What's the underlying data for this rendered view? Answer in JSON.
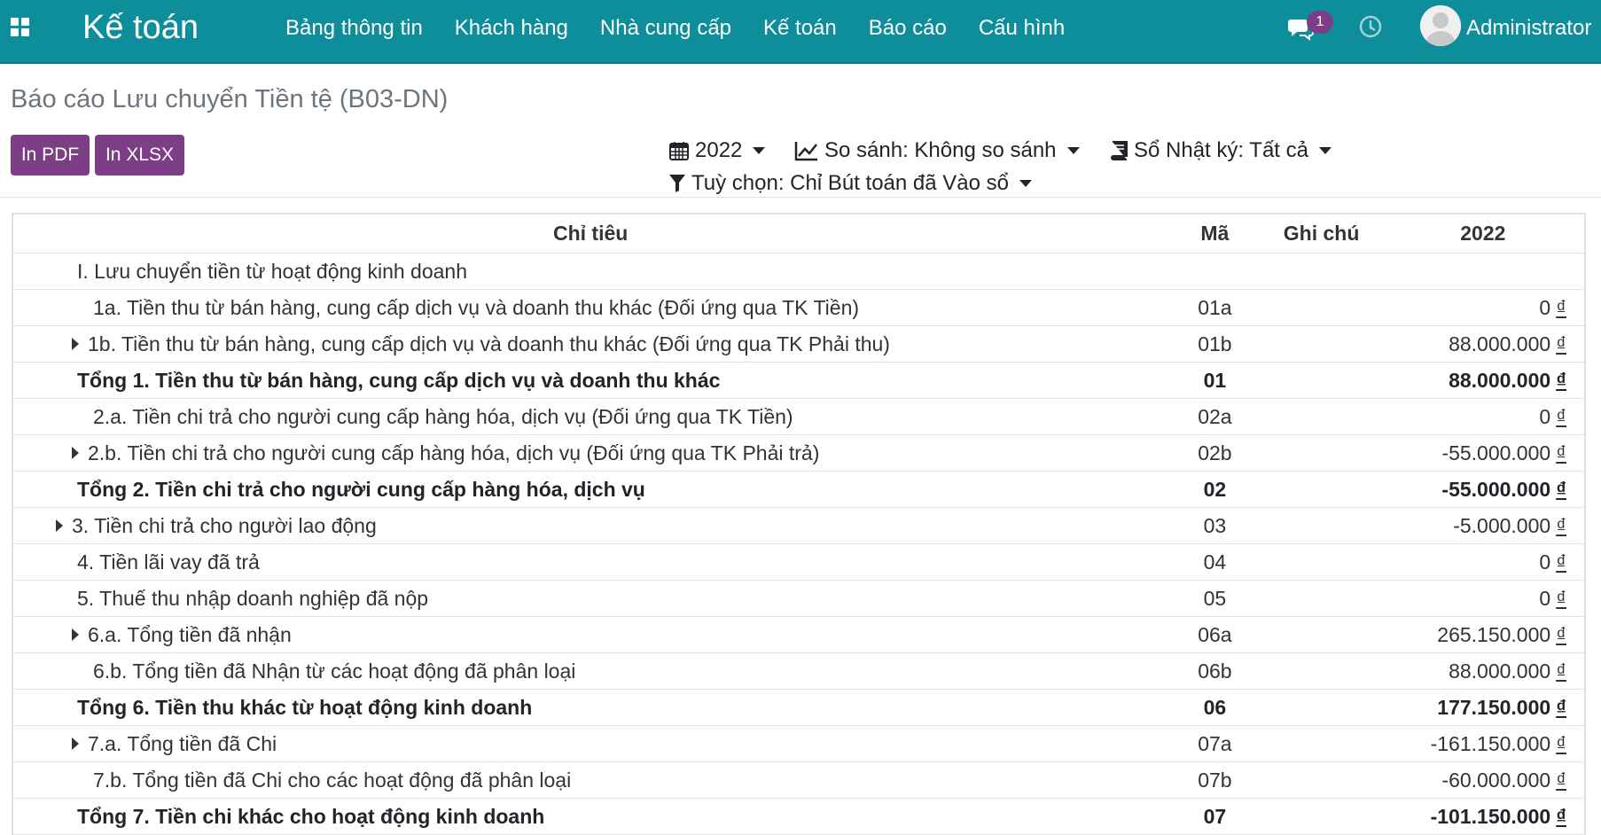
{
  "app": {
    "brand": "Kế toán",
    "menu": [
      "Bảng thông tin",
      "Khách hàng",
      "Nhà cung cấp",
      "Kế toán",
      "Báo cáo",
      "Cấu hình"
    ],
    "message_count": "1",
    "user": "Administrator"
  },
  "page": {
    "title": "Báo cáo Lưu chuyển Tiền tệ (B03-DN)",
    "btn_pdf": "In PDF",
    "btn_xlsx": "In XLSX",
    "filters": {
      "period": "2022",
      "compare": "So sánh: Không so sánh",
      "journals": "Sổ Nhật ký: Tất cả",
      "options": "Tuỳ chọn: Chỉ Bút toán đã Vào sổ"
    }
  },
  "table": {
    "headers": {
      "name": "Chỉ tiêu",
      "code": "Mã",
      "note": "Ghi chú",
      "value": "2022"
    },
    "currency": "₫",
    "rows": [
      {
        "name": "I. Lưu chuyển tiền từ hoạt động kinh doanh",
        "code": "",
        "value": "",
        "level": 1,
        "expand": false,
        "total": false
      },
      {
        "name": "1a. Tiền thu từ bán hàng, cung cấp dịch vụ và doanh thu khác (Đối ứng qua TK Tiền)",
        "code": "01a",
        "value": "0",
        "level": 2,
        "expand": false,
        "total": false
      },
      {
        "name": "1b. Tiền thu từ bán hàng, cung cấp dịch vụ và doanh thu khác (Đối ứng qua TK Phải thu)",
        "code": "01b",
        "value": "88.000.000",
        "level": 2,
        "expand": true,
        "total": false
      },
      {
        "name": "Tổng 1. Tiền thu từ bán hàng, cung cấp dịch vụ và doanh thu khác",
        "code": "01",
        "value": "88.000.000",
        "level": 1,
        "expand": false,
        "total": true
      },
      {
        "name": "2.a. Tiền chi trả cho người cung cấp hàng hóa, dịch vụ (Đối ứng qua TK Tiền)",
        "code": "02a",
        "value": "0",
        "level": 2,
        "expand": false,
        "total": false
      },
      {
        "name": "2.b. Tiền chi trả cho người cung cấp hàng hóa, dịch vụ (Đối ứng qua TK Phải trả)",
        "code": "02b",
        "value": "-55.000.000",
        "level": 2,
        "expand": true,
        "total": false
      },
      {
        "name": "Tổng 2. Tiền chi trả cho người cung cấp hàng hóa, dịch vụ",
        "code": "02",
        "value": "-55.000.000",
        "level": 1,
        "expand": false,
        "total": true
      },
      {
        "name": "3. Tiền chi trả cho người lao động",
        "code": "03",
        "value": "-5.000.000",
        "level": 1,
        "expand": true,
        "total": false
      },
      {
        "name": "4. Tiền lãi vay đã trả",
        "code": "04",
        "value": "0",
        "level": 1,
        "expand": false,
        "total": false
      },
      {
        "name": "5. Thuế thu nhập doanh nghiệp đã nộp",
        "code": "05",
        "value": "0",
        "level": 1,
        "expand": false,
        "total": false
      },
      {
        "name": "6.a. Tổng tiền đã nhận",
        "code": "06a",
        "value": "265.150.000",
        "level": 2,
        "expand": true,
        "total": false
      },
      {
        "name": "6.b. Tổng tiền đã Nhận từ các hoạt động đã phân loại",
        "code": "06b",
        "value": "88.000.000",
        "level": 2,
        "expand": false,
        "total": false
      },
      {
        "name": "Tổng 6. Tiền thu khác từ hoạt động kinh doanh",
        "code": "06",
        "value": "177.150.000",
        "level": 1,
        "expand": false,
        "total": true
      },
      {
        "name": "7.a. Tổng tiền đã Chi",
        "code": "07a",
        "value": "-161.150.000",
        "level": 2,
        "expand": true,
        "total": false
      },
      {
        "name": "7.b. Tổng tiền đã Chi cho các hoạt động đã phân loại",
        "code": "07b",
        "value": "-60.000.000",
        "level": 2,
        "expand": false,
        "total": false
      },
      {
        "name": "Tổng 7. Tiền chi khác cho hoạt động kinh doanh",
        "code": "07",
        "value": "-101.150.000",
        "level": 1,
        "expand": false,
        "total": true
      }
    ]
  }
}
